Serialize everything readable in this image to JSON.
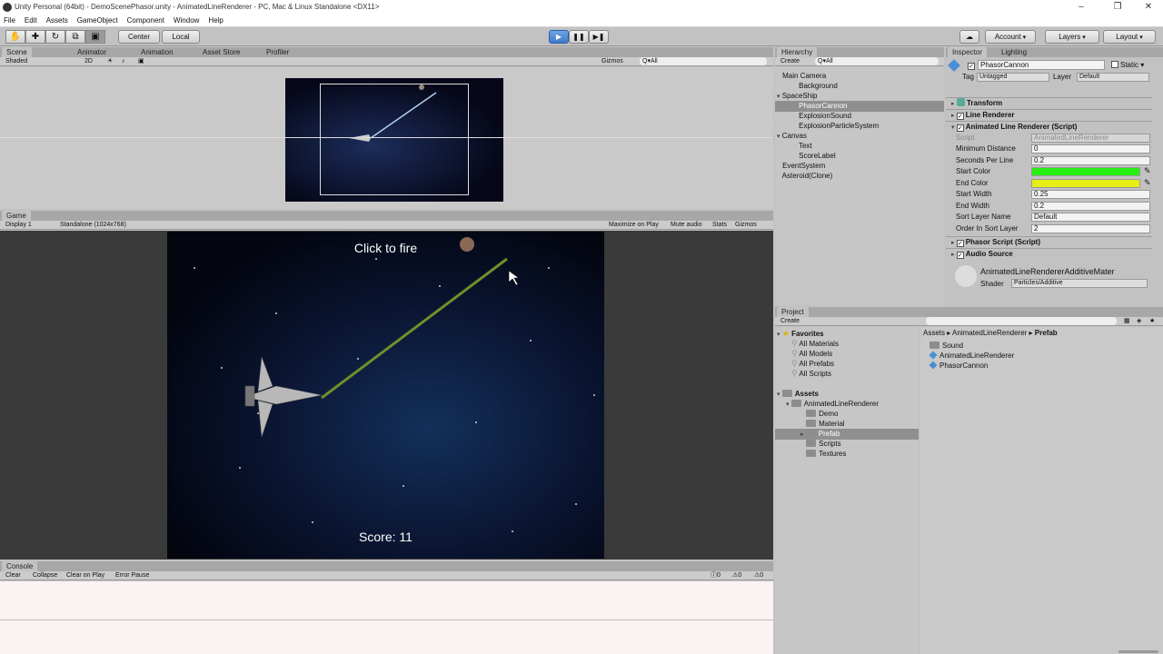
{
  "window": {
    "title": "Unity Personal (64bit) - DemoScenePhasor.unity - AnimatedLineRenderer - PC, Mac & Linux Standalone <DX11>"
  },
  "menu": [
    "File",
    "Edit",
    "Assets",
    "GameObject",
    "Component",
    "Window",
    "Help"
  ],
  "toolbar": {
    "center": "Center",
    "local": "Local",
    "account": "Account",
    "layers": "Layers",
    "layout": "Layout"
  },
  "scene": {
    "tabs": [
      "Scene",
      "Animator",
      "Animation",
      "Asset Store",
      "Profiler"
    ],
    "shading": "Shaded",
    "mode2d": "2D",
    "gizmos": "Gizmos",
    "search_placeholder": "Q▾All"
  },
  "game": {
    "tab": "Game",
    "display": "Display 1",
    "resolution": "Standalone (1024x768)",
    "buttons": [
      "Maximize on Play",
      "Mute audio",
      "Stats",
      "Gizmos"
    ],
    "click_to_fire": "Click to fire",
    "score": "Score: 11"
  },
  "console": {
    "tab": "Console",
    "buttons": [
      "Clear",
      "Collapse",
      "Clear on Play",
      "Error Pause"
    ],
    "counts": [
      "0",
      "0",
      "0"
    ]
  },
  "hierarchy": {
    "tab": "Hierarchy",
    "create": "Create",
    "search_placeholder": "Q▾All",
    "items": [
      {
        "label": "Main Camera",
        "indent": 0,
        "arrow": ""
      },
      {
        "label": "Background",
        "indent": 1,
        "arrow": ""
      },
      {
        "label": "SpaceShip",
        "indent": 0,
        "arrow": "▾"
      },
      {
        "label": "PhasorCannon",
        "indent": 1,
        "arrow": "",
        "selected": true
      },
      {
        "label": "ExplosionSound",
        "indent": 1,
        "arrow": ""
      },
      {
        "label": "ExplosionParticleSystem",
        "indent": 1,
        "arrow": ""
      },
      {
        "label": "Canvas",
        "indent": 0,
        "arrow": "▾"
      },
      {
        "label": "Text",
        "indent": 1,
        "arrow": ""
      },
      {
        "label": "ScoreLabel",
        "indent": 1,
        "arrow": ""
      },
      {
        "label": "EventSystem",
        "indent": 0,
        "arrow": ""
      },
      {
        "label": "Asteroid(Clone)",
        "indent": 0,
        "arrow": ""
      }
    ]
  },
  "inspector": {
    "tabs": [
      "Inspector",
      "Lighting"
    ],
    "object_name": "PhasorCannon",
    "static": "Static",
    "tag_label": "Tag",
    "tag_value": "Untagged",
    "layer_label": "Layer",
    "layer_value": "Default",
    "components": [
      "Transform",
      "Line Renderer",
      "Animated Line Renderer (Script)"
    ],
    "script_label": "Script",
    "script_value": "AnimatedLineRenderer",
    "props": [
      {
        "label": "Minimum Distance",
        "value": "0"
      },
      {
        "label": "Seconds Per Line",
        "value": "0.2"
      },
      {
        "label": "Start Color",
        "value": "",
        "color": "#28ee14"
      },
      {
        "label": "End Color",
        "value": "",
        "color": "#e6ee14"
      },
      {
        "label": "Start Width",
        "value": "0.25"
      },
      {
        "label": "End Width",
        "value": "0.2"
      },
      {
        "label": "Sort Layer Name",
        "value": "Default"
      },
      {
        "label": "Order In Sort Layer",
        "value": "2"
      }
    ],
    "components2": [
      "Phasor Script (Script)",
      "Audio Source"
    ],
    "material_name": "AnimatedLineRendererAdditiveMater",
    "shader_label": "Shader",
    "shader_value": "Particles/Additive"
  },
  "project": {
    "tab": "Project",
    "create": "Create",
    "favorites_label": "Favorites",
    "favorites": [
      "All Materials",
      "All Models",
      "All Prefabs",
      "All Scripts"
    ],
    "assets_label": "Assets",
    "tree": [
      {
        "label": "AnimatedLineRenderer",
        "level": 1
      },
      {
        "label": "Demo",
        "level": 2
      },
      {
        "label": "Material",
        "level": 2
      },
      {
        "label": "Prefab",
        "level": 2,
        "selected": true
      },
      {
        "label": "Scripts",
        "level": 2
      },
      {
        "label": "Textures",
        "level": 2
      }
    ],
    "breadcrumb": [
      "Assets",
      "AnimatedLineRenderer",
      "Prefab"
    ],
    "files": [
      {
        "label": "Sound",
        "kind": "folder"
      },
      {
        "label": "AnimatedLineRenderer",
        "kind": "prefab"
      },
      {
        "label": "PhasorCannon",
        "kind": "prefab"
      }
    ]
  }
}
